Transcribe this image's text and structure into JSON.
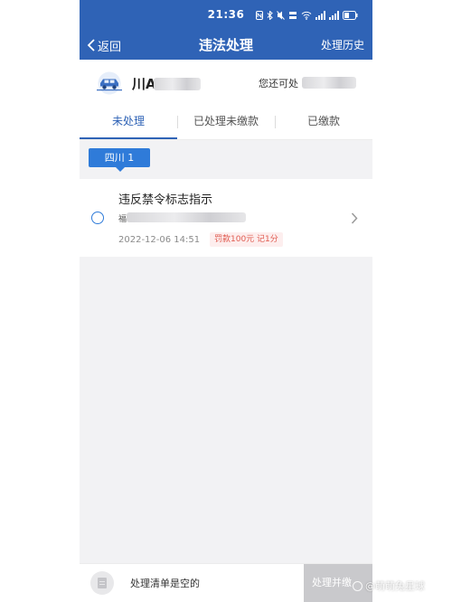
{
  "status_bar": {
    "time": "21:36"
  },
  "nav": {
    "back_label": "返回",
    "title": "违法处理",
    "history_label": "处理历史"
  },
  "vehicle": {
    "plate": "川A",
    "remaining_prefix": "您还可处"
  },
  "tabs": [
    {
      "label": "未处理",
      "active": true
    },
    {
      "label": "已处理未缴款",
      "active": false
    },
    {
      "label": "已缴款",
      "active": false
    }
  ],
  "region_chip": "四川 1",
  "violation": {
    "title": "违反禁令标志指示",
    "location_first_char": "福",
    "datetime": "2022-12-06 14:51",
    "penalty": "罚款100元 记1分"
  },
  "bottom_bar": {
    "empty_text": "处理清单是空的",
    "button_label": "处理并缴"
  },
  "watermark": {
    "text": "@萌萌兔星球"
  },
  "colors": {
    "primary": "#2f63b6",
    "accent": "#2f7bd9",
    "penalty": "#e05a4f"
  }
}
